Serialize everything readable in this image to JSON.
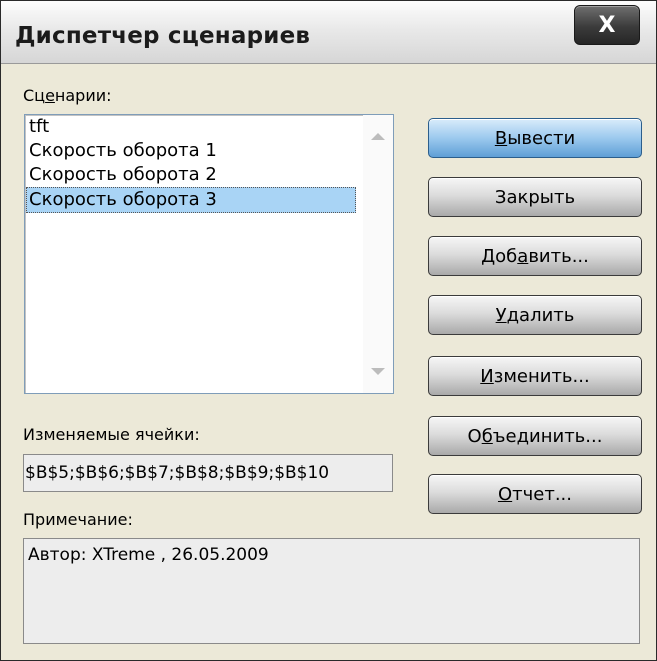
{
  "window": {
    "title": "Диспетчер сценариев",
    "close_label": "X"
  },
  "scenarios": {
    "label_pre": "Сц",
    "label_accel": "е",
    "label_post": "нарии:",
    "items": [
      "tft",
      "Скорость оборота 1",
      "Скорость оборота 2",
      "Скорость оборота 3"
    ],
    "selected_index": 3
  },
  "buttons": {
    "show": {
      "accel": "В",
      "rest": "ывести"
    },
    "close": {
      "label": "Закрыть"
    },
    "add": {
      "pre": "Доб",
      "accel": "а",
      "post": "вить..."
    },
    "delete": {
      "accel": "У",
      "rest": "далить"
    },
    "edit": {
      "accel": "И",
      "rest": "зменить..."
    },
    "merge": {
      "pre": "О",
      "accel": "б",
      "post": "ъединить..."
    },
    "report": {
      "accel": "О",
      "rest": "тчет..."
    }
  },
  "changing_cells": {
    "label": "Изменяемые ячейки:",
    "value": "$B$5;$B$6;$B$7;$B$8;$B$9;$B$10"
  },
  "comment": {
    "label": "Примечание:",
    "value": "Автор: XTreme , 26.05.2009"
  },
  "colors": {
    "selection": "#a9d4f5",
    "default_button": "#9cc9ee"
  }
}
